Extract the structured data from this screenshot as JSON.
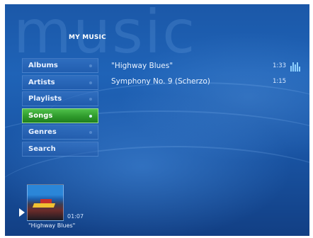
{
  "header": {
    "watermark": "music",
    "title": "MY MUSIC"
  },
  "nav": {
    "items": [
      {
        "label": "Albums"
      },
      {
        "label": "Artists"
      },
      {
        "label": "Playlists"
      },
      {
        "label": "Songs",
        "selected": true
      },
      {
        "label": "Genres"
      },
      {
        "label": "Search"
      }
    ]
  },
  "songs": [
    {
      "title": "\"Highway Blues\"",
      "duration": "1:33",
      "playing": true
    },
    {
      "title": "Symphony No. 9 (Scherzo)",
      "duration": "1:15"
    }
  ],
  "now_playing": {
    "elapsed": "01:07",
    "title": "\"Highway Blues\""
  },
  "colors": {
    "background": "#1b58a8",
    "selected": "#2f9a2c",
    "text": "#eaf3ff"
  }
}
